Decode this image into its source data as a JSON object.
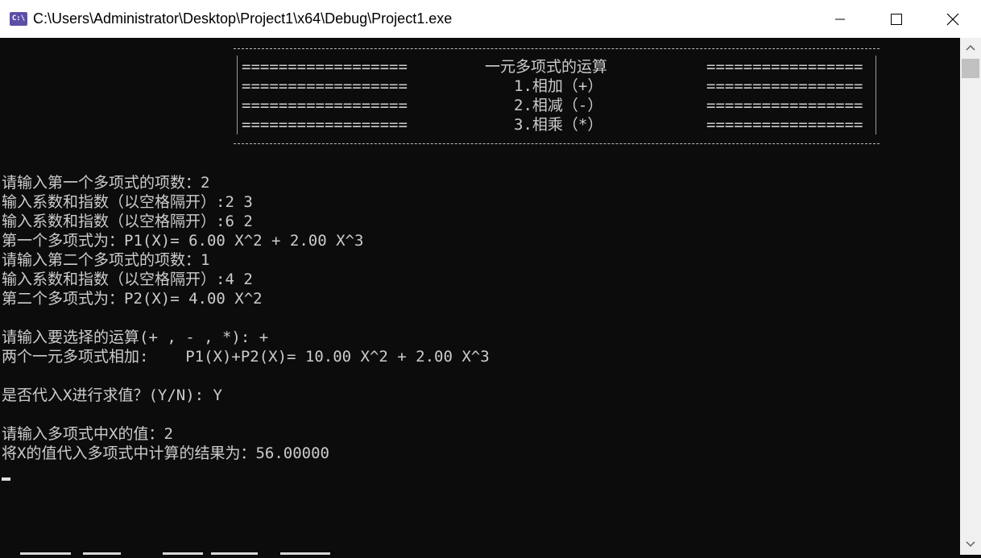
{
  "window": {
    "title": "C:\\Users\\Administrator\\Desktop\\Project1\\x64\\Debug\\Project1.exe",
    "icon_label": "C:\\",
    "controls": [
      "minimize-icon",
      "maximize-icon",
      "close-icon"
    ]
  },
  "menu": {
    "left_bar": "==================",
    "right_bar": "=================",
    "rows": [
      "一元多项式的运算",
      "1.相加（+）",
      "2.相减（-）",
      "3.相乘（*）"
    ]
  },
  "console": {
    "lines": [
      "请输入第一个多项式的项数：2",
      "输入系数和指数（以空格隔开）:2 3",
      "输入系数和指数（以空格隔开）:6 2",
      "第一个多项式为：P1(X)= 6.00 X^2 + 2.00 X^3",
      "请输入第二个多项式的项数：1",
      "输入系数和指数（以空格隔开）:4 2",
      "第二个多项式为：P2(X)= 4.00 X^2",
      "请输入要选择的运算(+ , - , *): +",
      "两个一元多项式相加:    P1(X)+P2(X)= 10.00 X^2 + 2.00 X^3",
      "是否代入X进行求值？(Y/N): Y",
      "请输入多项式中X的值：2",
      "将X的值代入多项式中计算的结果为：56.00000"
    ]
  },
  "colors": {
    "console_bg": "#0c0c0c",
    "console_text": "#cccccc",
    "titlebar_bg": "#ffffff",
    "icon_bg": "#5b4fa8",
    "scrollbar_bg": "#f0f0f0",
    "scrollbar_thumb": "#c1c1c1"
  }
}
